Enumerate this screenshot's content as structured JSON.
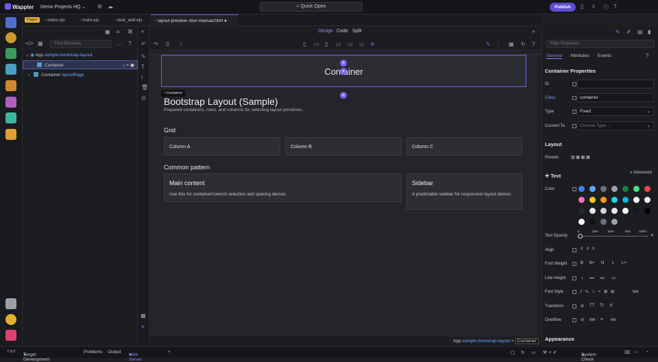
{
  "app": {
    "logo": "Wappler",
    "project": "Demo Projects HQ",
    "quick_open": "Quick Open",
    "publish": "Publish"
  },
  "tabs": {
    "pages_badge": "Pages",
    "items": [
      "index.ejs",
      "main.ejs",
      "task_add.ejs",
      "layout-preview--tour-manual.html"
    ]
  },
  "tree": {
    "find_placeholder": "Find Elements",
    "app_label": "App",
    "app_name": "sample-bootstrap-layout",
    "container": "Container",
    "container_layout": "Container",
    "layout_name": "layoutPage"
  },
  "view_modes": [
    "Design",
    "Code",
    "Split"
  ],
  "canvas": {
    "hero_text": "Container",
    "crumb_tag": "Container",
    "title": "Bootstrap Layout (Sample)",
    "subtitle": "Prepared containers, rows, and columns for selecting layout primitives.",
    "grid_heading": "Grid",
    "columns": [
      "Column A",
      "Column B",
      "Column C"
    ],
    "pattern_heading": "Common pattern",
    "main_title": "Main content",
    "main_desc": "Use this for container/row/col selection and spacing demos.",
    "side_title": "Sidebar",
    "side_desc": "A predictable sidebar for responsive layout demos."
  },
  "breadcrumb": {
    "app": "App",
    "name": "sample-bootstrap-layout",
    "sep": ">",
    "current": "Container"
  },
  "props": {
    "filter_placeholder": "Filter Properties",
    "tabs": [
      "General",
      "Attributes",
      "Events"
    ],
    "section": "Container Properties",
    "id_label": "ID",
    "class_label": "Class",
    "class_value": "container",
    "type_label": "Type",
    "type_value": "Fixed",
    "convert_label": "Convert To",
    "convert_placeholder": "Choose Type ...",
    "layout": "Layout",
    "presets": "Presets",
    "text": "Text",
    "advanced": "Advanced",
    "color": "Color",
    "text_opacity": "Text Opacity",
    "opacity_ticks": [
      "0",
      "25%",
      "50%",
      "75%",
      "100%"
    ],
    "align": "Align",
    "font_weight": "Font Weight",
    "weights": [
      "B",
      "B+",
      "N",
      "L",
      "L+"
    ],
    "line_height": "Line Height",
    "lh_values": [
      "1",
      "SM",
      "BS",
      "LG"
    ],
    "font_style": "Font Style",
    "na": "N/A",
    "transform": "Transform",
    "transforms": [
      "TT",
      "Tt",
      "tt"
    ],
    "overflow": "Overflow",
    "overflows": [
      "NW",
      "Wb"
    ],
    "appearance": "Appearance"
  },
  "swatches": [
    "#3b82f6",
    "#60a5fa",
    "#6b7280",
    "#9ca3af",
    "#15803d",
    "#4ade80",
    "#ef4444",
    "#f472b6",
    "#facc15",
    "#f59e0b",
    "#22d3ee",
    "#06b6d4",
    "#ffffff",
    "#f3f4f6",
    "#1f2937",
    "#e5e7eb",
    "#d1d5db",
    "#e5e7eb",
    "#f9fafb",
    "#111827",
    "#000000",
    "#ffffff",
    "#111111",
    "#6b7280",
    "#9ca3af"
  ],
  "status": {
    "version": "7.9.2",
    "target": "Target: Development",
    "problems": "Problems",
    "output": "Output",
    "webserver": "Web Server",
    "system_check": "System Check"
  }
}
